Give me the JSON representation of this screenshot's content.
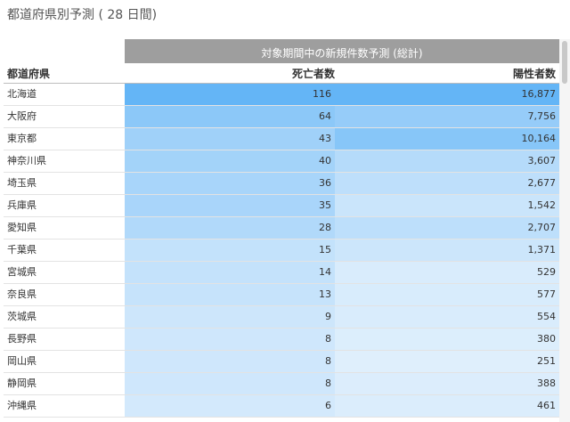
{
  "page": {
    "title": "都道府県別予測 ( 28 日間)"
  },
  "table": {
    "group_header": "対象期間中の新規件数予測 (総計)",
    "columns": {
      "prefecture": "都道府県",
      "deaths": "死亡者数",
      "positives": "陽性者数"
    },
    "rows": [
      {
        "prefecture": "北海道",
        "deaths": "116",
        "positives": "16,877",
        "deaths_value": 116,
        "positives_value": 16877
      },
      {
        "prefecture": "大阪府",
        "deaths": "64",
        "positives": "7,756",
        "deaths_value": 64,
        "positives_value": 7756
      },
      {
        "prefecture": "東京都",
        "deaths": "43",
        "positives": "10,164",
        "deaths_value": 43,
        "positives_value": 10164
      },
      {
        "prefecture": "神奈川県",
        "deaths": "40",
        "positives": "3,607",
        "deaths_value": 40,
        "positives_value": 3607
      },
      {
        "prefecture": "埼玉県",
        "deaths": "36",
        "positives": "2,677",
        "deaths_value": 36,
        "positives_value": 2677
      },
      {
        "prefecture": "兵庫県",
        "deaths": "35",
        "positives": "1,542",
        "deaths_value": 35,
        "positives_value": 1542
      },
      {
        "prefecture": "愛知県",
        "deaths": "28",
        "positives": "2,707",
        "deaths_value": 28,
        "positives_value": 2707
      },
      {
        "prefecture": "千葉県",
        "deaths": "15",
        "positives": "1,371",
        "deaths_value": 15,
        "positives_value": 1371
      },
      {
        "prefecture": "宮城県",
        "deaths": "14",
        "positives": "529",
        "deaths_value": 14,
        "positives_value": 529
      },
      {
        "prefecture": "奈良県",
        "deaths": "13",
        "positives": "577",
        "deaths_value": 13,
        "positives_value": 577
      },
      {
        "prefecture": "茨城県",
        "deaths": "9",
        "positives": "554",
        "deaths_value": 9,
        "positives_value": 554
      },
      {
        "prefecture": "長野県",
        "deaths": "8",
        "positives": "380",
        "deaths_value": 8,
        "positives_value": 380
      },
      {
        "prefecture": "岡山県",
        "deaths": "8",
        "positives": "251",
        "deaths_value": 8,
        "positives_value": 251
      },
      {
        "prefecture": "静岡県",
        "deaths": "8",
        "positives": "388",
        "deaths_value": 8,
        "positives_value": 388
      },
      {
        "prefecture": "沖縄県",
        "deaths": "6",
        "positives": "461",
        "deaths_value": 6,
        "positives_value": 461
      }
    ]
  },
  "colors": {
    "group_header_bg": "#9e9e9e",
    "heat_high": "#64b5f6",
    "heat_low": "#eaf4fd"
  }
}
